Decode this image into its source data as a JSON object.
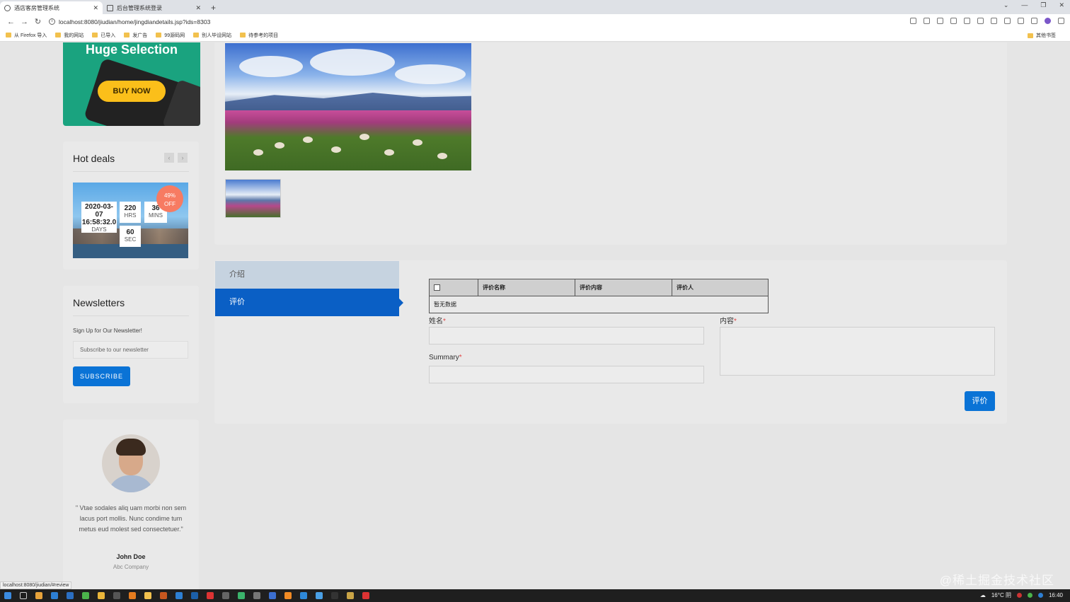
{
  "browser": {
    "tabs": [
      {
        "title": "酒店客房管理系统",
        "active": true
      },
      {
        "title": "后台管理系统登录",
        "active": false
      }
    ],
    "new_tab": "+",
    "url": "localhost:8080/jiudian/home/jingdiandetails.jsp?ids=8303",
    "bookmarks": [
      "从 Firefox 导入",
      "我的网站",
      "已导入",
      "发广告",
      "99源码网",
      "别人毕设网站",
      "待参考的项目"
    ],
    "bookmarks_other": "其他书签",
    "status_url": "localhost:8080/jiudian/#review"
  },
  "sidebar": {
    "promo": {
      "title": "Huge Selection",
      "button": "BUY NOW"
    },
    "hot_deals": {
      "title": "Hot deals",
      "badge_percent": "49%",
      "badge_off": "OFF",
      "date": "2020-03-07 16:58:32.0",
      "days_label": "DAYS",
      "hrs": "220",
      "hrs_label": "HRS",
      "mins": "36",
      "mins_label": "MINS",
      "sec": "60",
      "sec_label": "SEC"
    },
    "newsletter": {
      "title": "Newsletters",
      "text": "Sign Up for Our Newsletter!",
      "placeholder": "Subscribe to our newsletter",
      "button": "SUBSCRIBE"
    },
    "testimonial": {
      "quote": "\" Vtae sodales aliq uam morbi non sem lacus port mollis. Nunc condime tum metus eud molest sed consectetuer.\"",
      "name": "John Doe",
      "company": "Abc Company"
    }
  },
  "detail": {
    "tabs": {
      "intro": "介绍",
      "review": "评价"
    },
    "table": {
      "headers": [
        "评价名称",
        "评价内容",
        "评价人"
      ],
      "empty": "暂无数据"
    },
    "form": {
      "name_label": "姓名",
      "summary_label": "Summary",
      "content_label": "内容",
      "required_mark": "*",
      "submit": "评价"
    }
  },
  "taskbar": {
    "weather": "16°C 阴",
    "time": "16:40"
  },
  "watermark": "@稀土掘金技术社区",
  "colors": {
    "primary": "#0a73d6",
    "active_tab": "#0a5fc5",
    "inactive_tab": "#c6d3e0",
    "promo_green": "#1aa37f",
    "buy_yellow": "#fbbf1a",
    "badge": "#f77b62"
  }
}
